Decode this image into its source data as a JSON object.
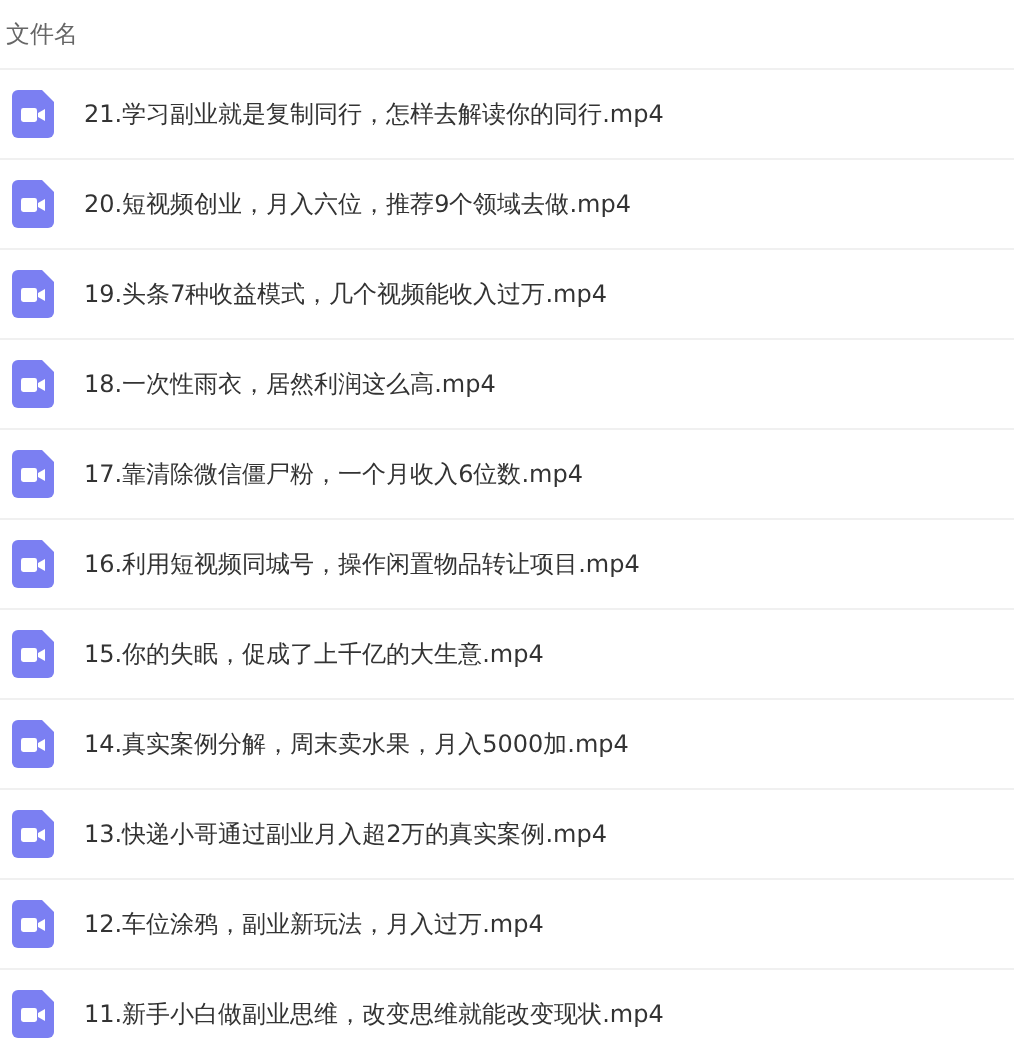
{
  "header": {
    "label": "文件名"
  },
  "files": [
    {
      "name": "21.学习副业就是复制同行，怎样去解读你的同行.mp4"
    },
    {
      "name": "20.短视频创业，月入六位，推荐9个领域去做.mp4"
    },
    {
      "name": "19.头条7种收益模式，几个视频能收入过万.mp4"
    },
    {
      "name": "18.一次性雨衣，居然利润这么高.mp4"
    },
    {
      "name": "17.靠清除微信僵尸粉，一个月收入6位数.mp4"
    },
    {
      "name": "16.利用短视频同城号，操作闲置物品转让项目.mp4"
    },
    {
      "name": "15.你的失眠，促成了上千亿的大生意.mp4"
    },
    {
      "name": "14.真实案例分解，周末卖水果，月入5000加.mp4"
    },
    {
      "name": "13.快递小哥通过副业月入超2万的真实案例.mp4"
    },
    {
      "name": "12.车位涂鸦，副业新玩法，月入过万.mp4"
    },
    {
      "name": "11.新手小白做副业思维，改变思维就能改变现状.mp4"
    }
  ]
}
